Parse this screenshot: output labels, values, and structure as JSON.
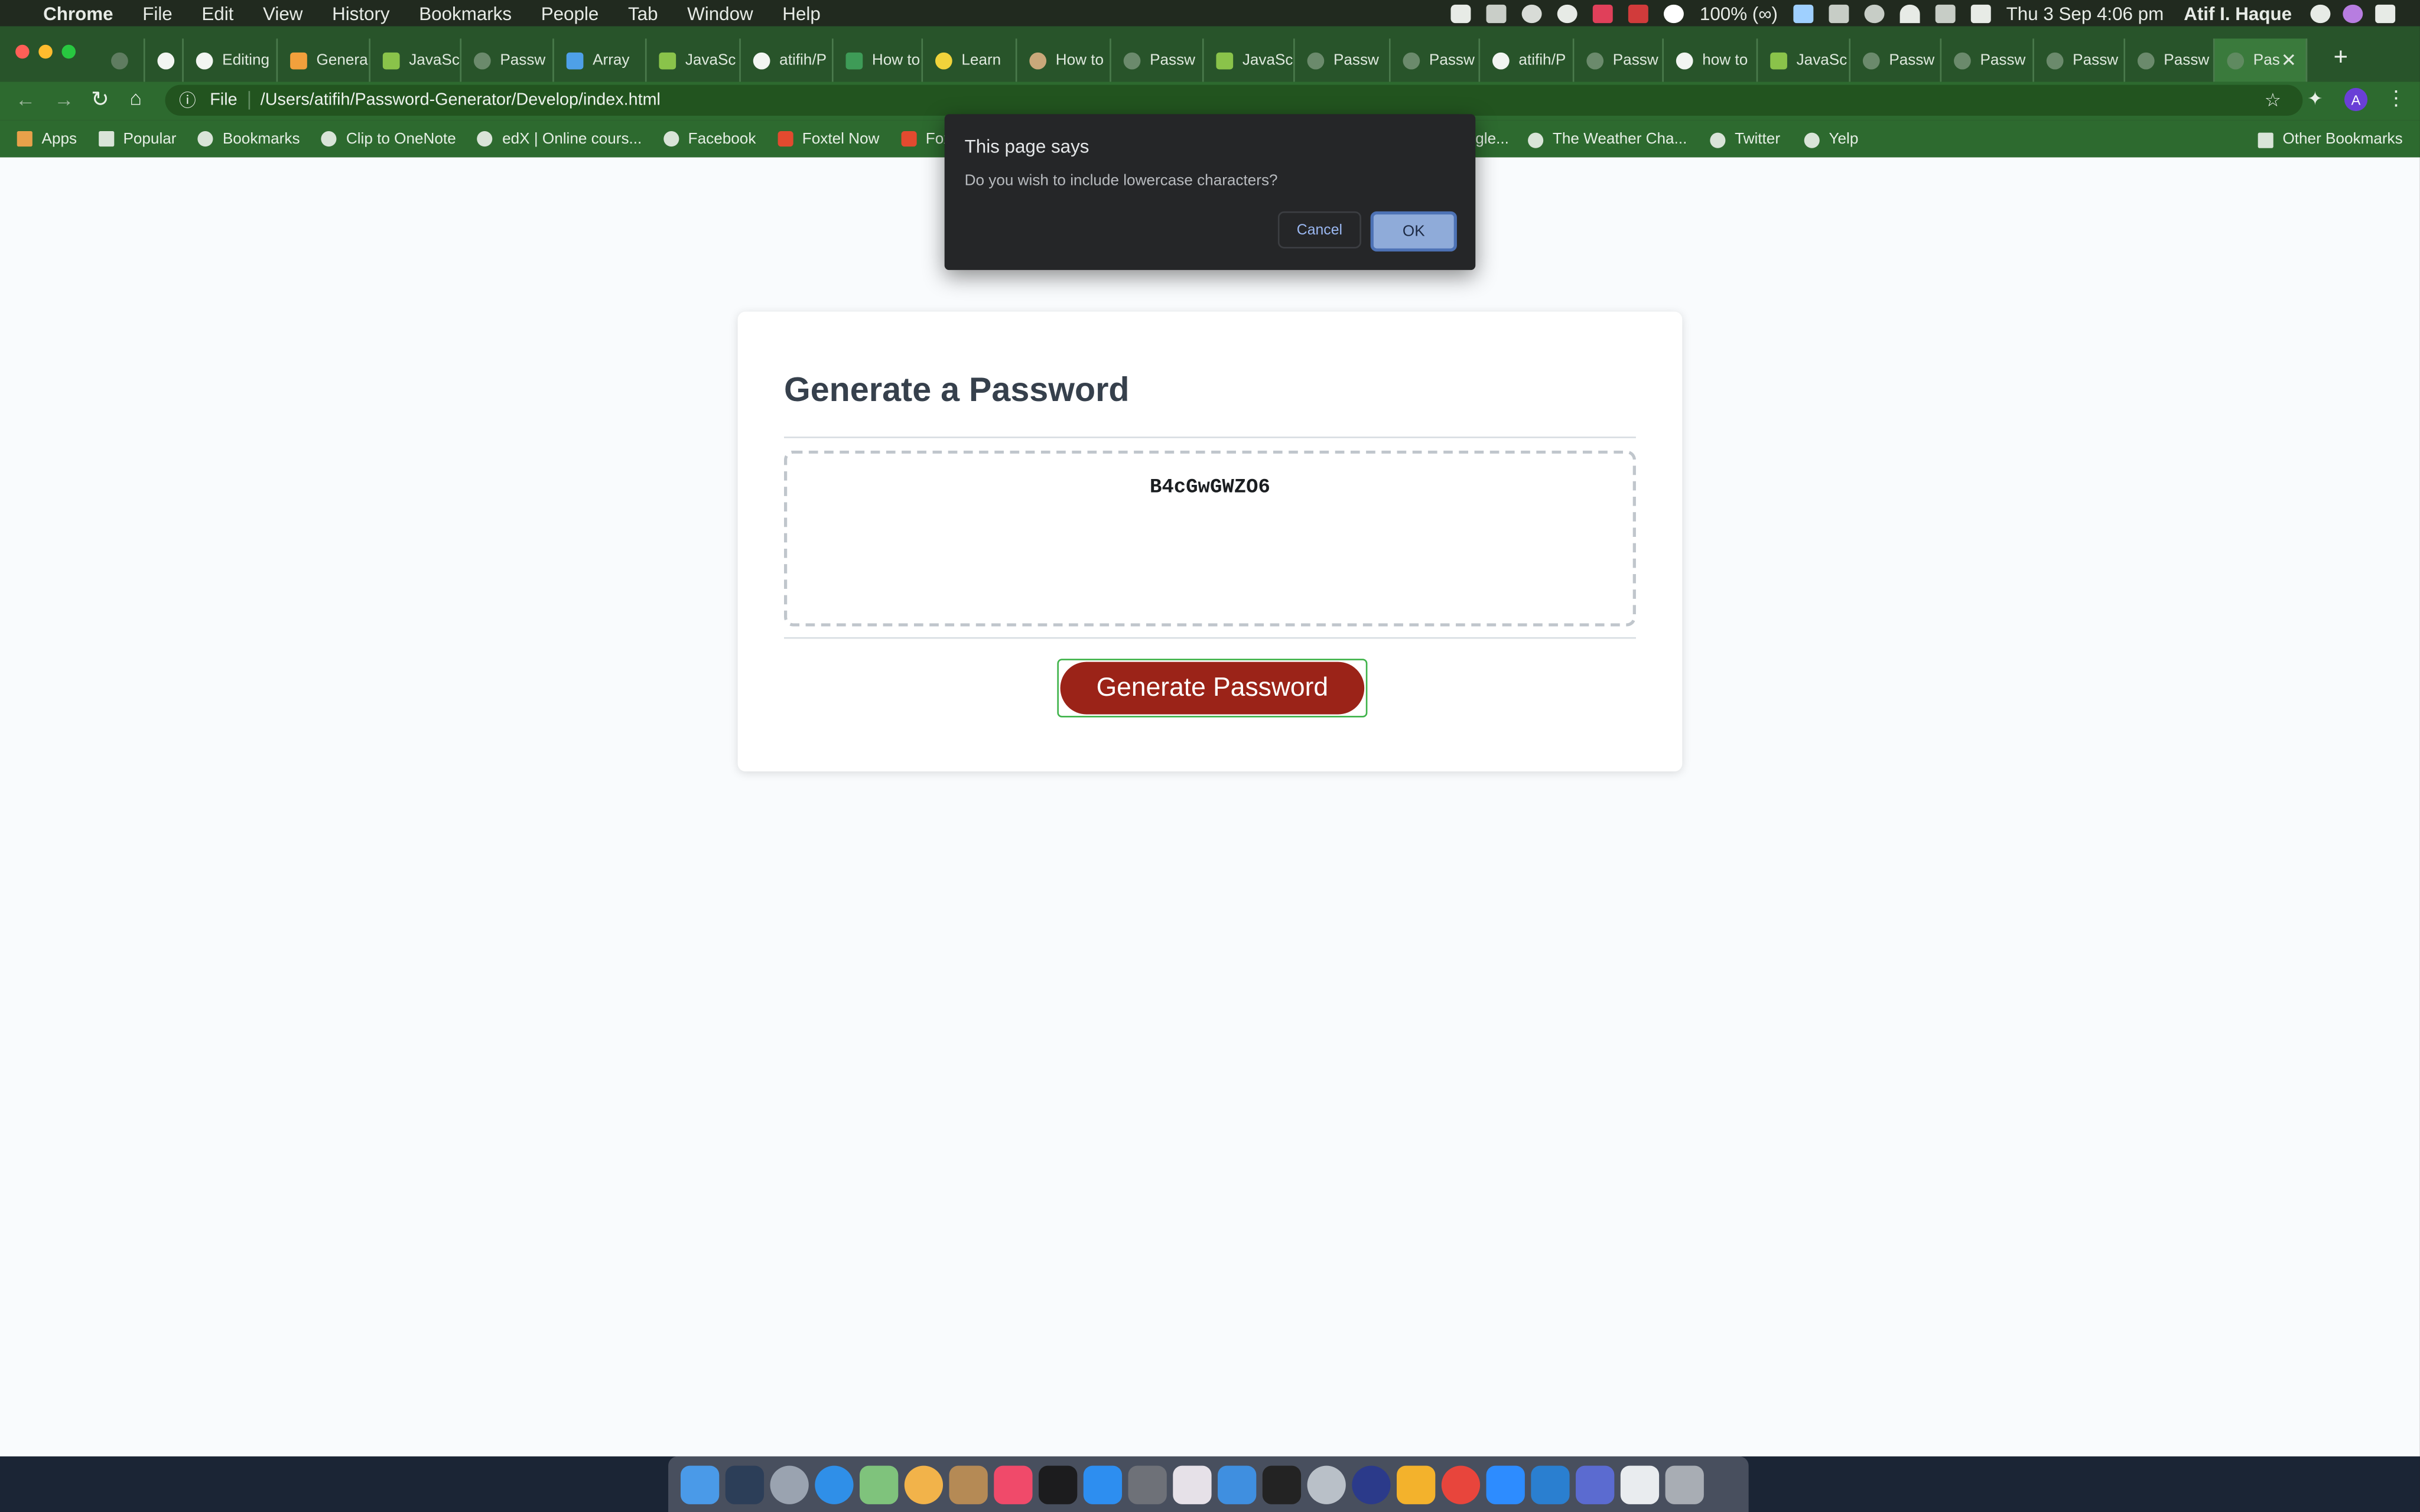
{
  "menubar": {
    "app": "Chrome",
    "items": [
      "File",
      "Edit",
      "View",
      "History",
      "Bookmarks",
      "People",
      "Tab",
      "Window",
      "Help"
    ],
    "battery": "100% (∞)",
    "datetime": "Thu 3 Sep  4:06 pm",
    "user": "Atif I. Haque"
  },
  "tabs": [
    "",
    "",
    "Editing",
    "Genera",
    "JavaSc",
    "Passw",
    "Array",
    "JavaSc",
    "atifih/P",
    "How to",
    "Learn",
    "How to",
    "Passw",
    "JavaSc",
    "Passw",
    "Passw",
    "atifih/P",
    "Passw",
    "how to",
    "JavaSc",
    "Passw",
    "Passw",
    "Passw",
    "Passw",
    "Pas"
  ],
  "address": {
    "scheme_label": "File",
    "url": "/Users/atifih/Password-Generator/Develop/index.html"
  },
  "bookmarks": {
    "items": [
      "Apps",
      "Popular",
      "Bookmarks",
      "Clip to OneNote",
      "edX | Online cours...",
      "Facebook",
      "Foxtel Now",
      "Foxt",
      "gle...",
      "The Weather Cha...",
      "Twitter",
      "Yelp"
    ],
    "other": "Other Bookmarks"
  },
  "dialog": {
    "title": "This page says",
    "message": "Do you wish to include lowercase characters?",
    "cancel": "Cancel",
    "ok": "OK"
  },
  "card": {
    "heading": "Generate a Password",
    "password": "B4cGwGWZO6",
    "button": "Generate Password"
  },
  "colors": {
    "chrome_green": "#2d6a2f",
    "button_red": "#9b2318",
    "dialog_bg": "#252628"
  }
}
